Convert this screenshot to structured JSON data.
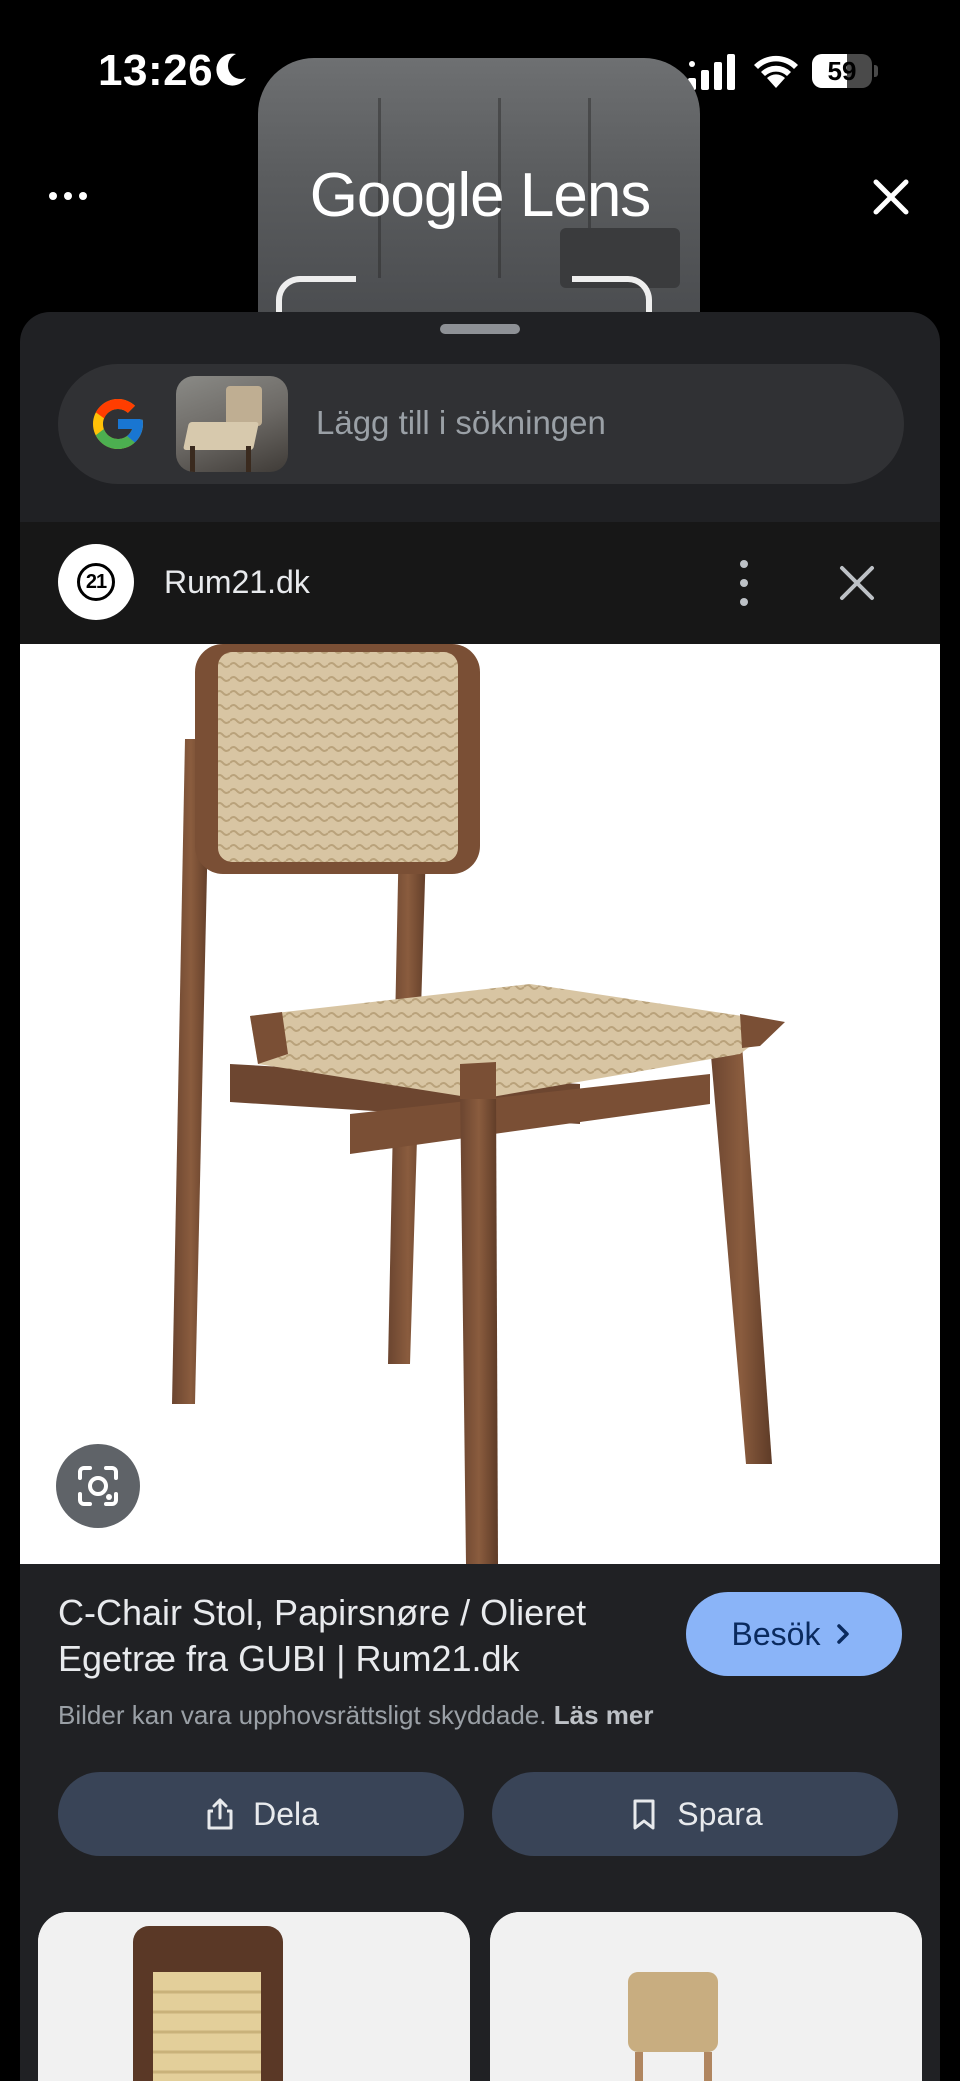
{
  "status_bar": {
    "time": "13:26",
    "battery_level": "59",
    "battery_fraction": 0.59
  },
  "header": {
    "title_brand": "Google",
    "title_product": "Lens"
  },
  "search": {
    "placeholder": "Lägg till i sökningen"
  },
  "source": {
    "logo_text": "21",
    "name": "Rum21.dk"
  },
  "result": {
    "title": "C-Chair Stol, Papirsnøre / Olieret Egetræ fra GUBI | Rum21.dk",
    "visit_label": "Besök",
    "copyright_notice": "Bilder kan vara upphovsrättsligt skyddade.",
    "read_more": "Läs mer"
  },
  "actions": {
    "share_label": "Dela",
    "save_label": "Spara"
  },
  "colors": {
    "accent": "#8ab4f8",
    "sheet_background": "#202124",
    "action_button": "#394457"
  }
}
